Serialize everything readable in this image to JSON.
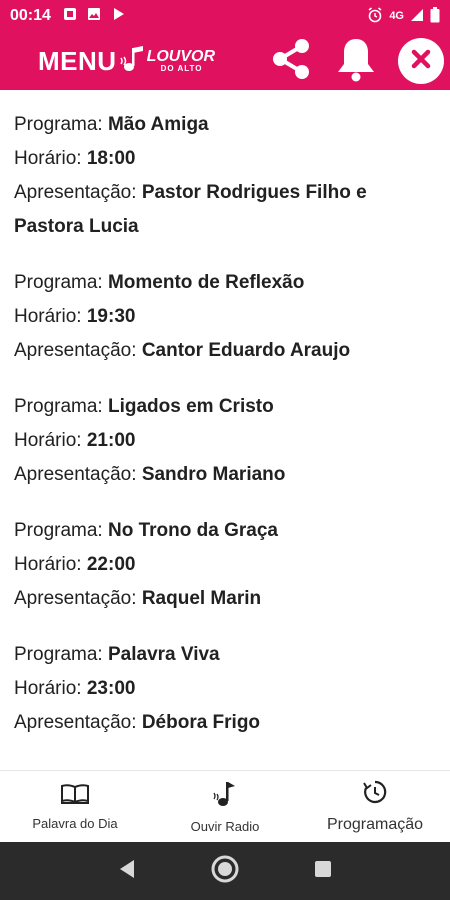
{
  "status_bar": {
    "time": "00:14",
    "network": "4G"
  },
  "app_bar": {
    "menu_label": "MENU",
    "logo_line1": "LOUVOR",
    "logo_line2": "DO ALTO",
    "accent_color": "#e0115f"
  },
  "labels": {
    "programa": "Programa: ",
    "horario": "Horário: ",
    "apresentacao": "Apresentação: "
  },
  "programs": [
    {
      "programa": "Mão Amiga",
      "horario": "18:00",
      "apresentacao": "Pastor Rodrigues Filho e Pastora Lucia"
    },
    {
      "programa": "Momento de Reflexão",
      "horario": "19:30",
      "apresentacao": "Cantor Eduardo Araujo"
    },
    {
      "programa": "Ligados em Cristo",
      "horario": "21:00",
      "apresentacao": "Sandro Mariano"
    },
    {
      "programa": "No Trono da Graça",
      "horario": "22:00",
      "apresentacao": "Raquel Marin"
    },
    {
      "programa": "Palavra Viva",
      "horario": "23:00",
      "apresentacao": "Débora Frigo"
    }
  ],
  "bottom_nav": [
    {
      "label": "Palavra do Dia",
      "icon": "book-icon"
    },
    {
      "label": "Ouvir Radio",
      "icon": "music-note-icon"
    },
    {
      "label": "Programação",
      "icon": "schedule-icon"
    }
  ]
}
